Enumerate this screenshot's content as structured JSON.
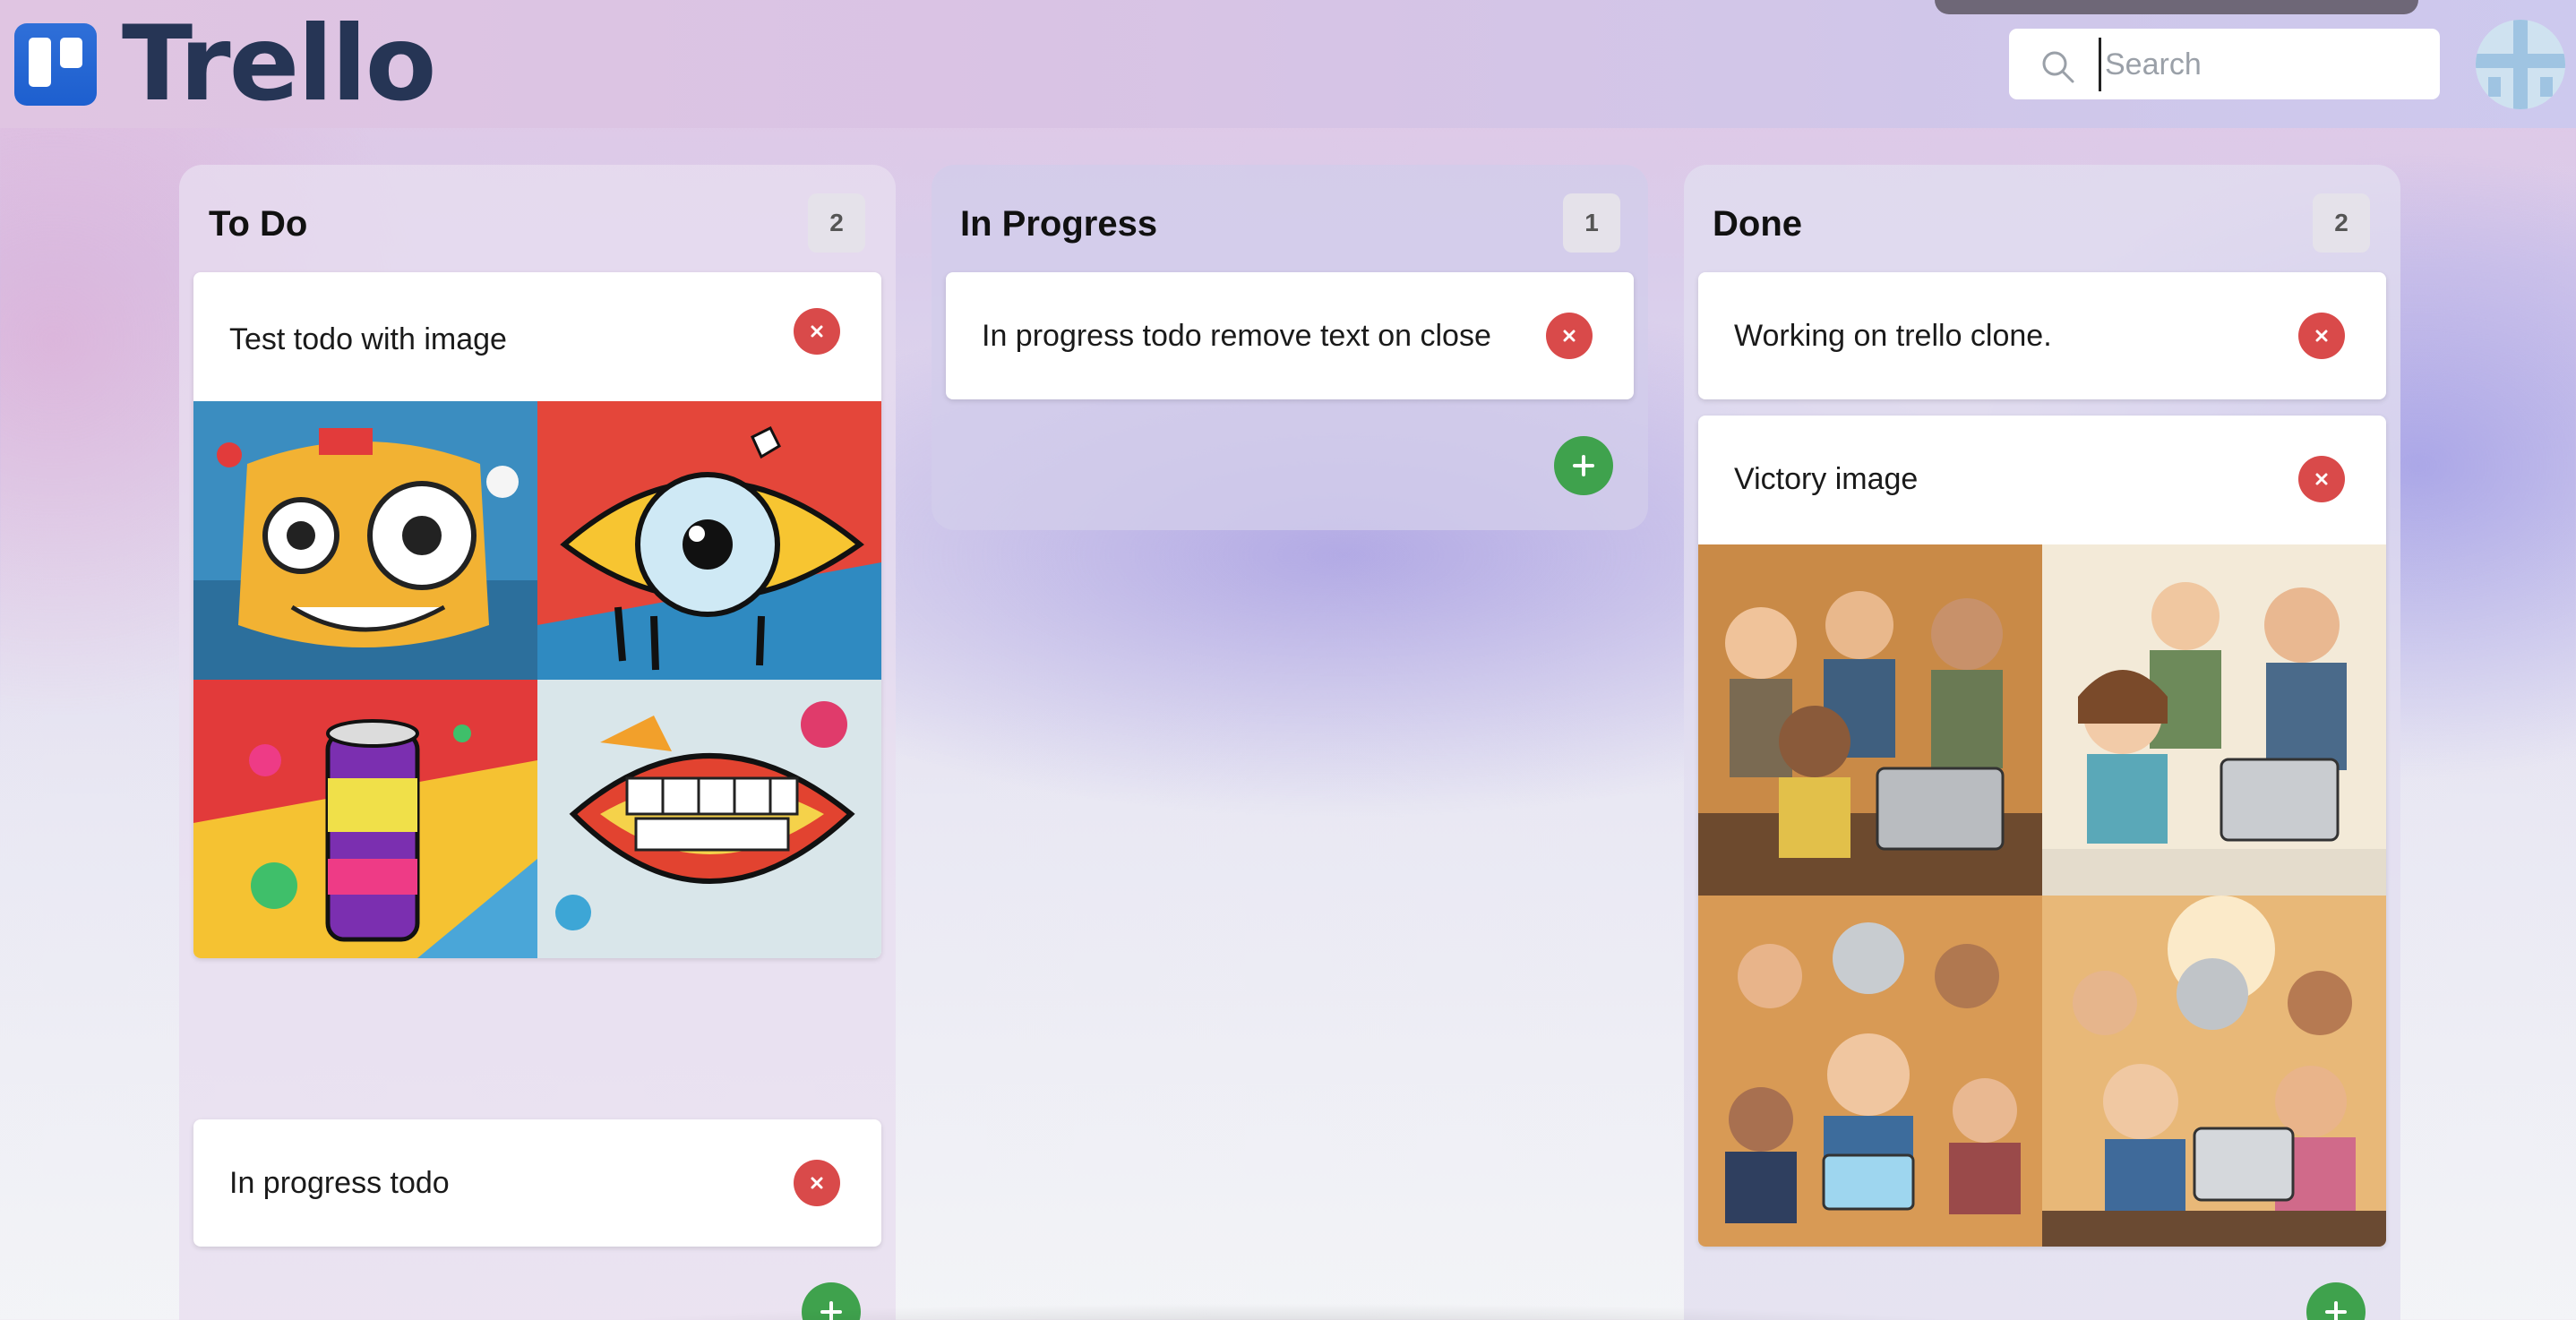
{
  "app": {
    "name": "Trello"
  },
  "search": {
    "placeholder": "Search",
    "value": ""
  },
  "colors": {
    "delete": "#d94a4a",
    "add": "#3fa24d",
    "logo": "#263555",
    "accent": "#1d5fcf"
  },
  "columns": [
    {
      "title": "To Do",
      "count": "2",
      "cards": [
        {
          "text": "Test todo with image",
          "has_image": true
        },
        {
          "text": "In progress todo",
          "has_image": false
        }
      ]
    },
    {
      "title": "In Progress",
      "count": "1",
      "cards": [
        {
          "text": "In progress todo remove text on close",
          "has_image": false
        }
      ]
    },
    {
      "title": "Done",
      "count": "2",
      "cards": [
        {
          "text": "Working on trello clone.",
          "has_image": false
        },
        {
          "text": "Victory image",
          "has_image": true
        }
      ]
    }
  ],
  "icons": {
    "delete": "close-icon",
    "add": "plus-icon",
    "search": "search-icon"
  }
}
